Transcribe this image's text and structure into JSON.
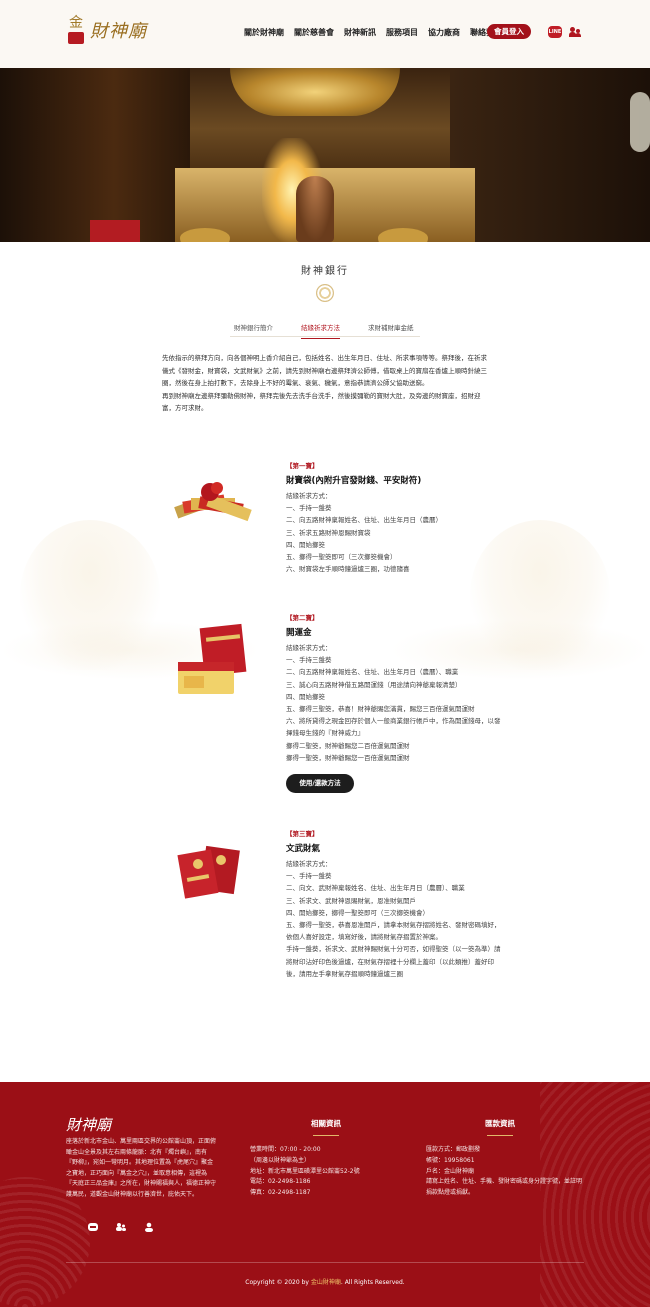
{
  "header": {
    "logo_text": "財神廟",
    "logo_mark": "金",
    "nav": [
      "關於財神廟",
      "關於慈善會",
      "財神新訊",
      "服務項目",
      "協力廠商",
      "聯絡我們"
    ],
    "login_label": "會員登入",
    "line_label": "LINE"
  },
  "page": {
    "title": "財神銀行",
    "tabs": [
      "財神銀行簡介",
      "結緣祈求方法",
      "求財補財庫金紙"
    ],
    "active_tab": 1,
    "intro": "先依指示的祭拜方向，向各個神明上香介紹自己，包括姓名、出生年月日、住址、所求事項等等。祭拜後，在祈求儀式《發財金，財寶袋，文武財氣》之前，請先到財神廟右邊祭拜濟公師傅，借取桌上的寶扇在香爐上順時針繞三圈，然後在身上拍打數下，去除身上不好的霉氣、衰氣、穢氣，意指恭請濟公師父協助送窮。\n再到財神廟左邊祭拜彌勒佛財神，祭拜完後先去洗手台洗手，然後摸彌勒的寶財大肚，及旁邊的財寶座，招財迎富，方可求財。"
  },
  "items": [
    {
      "tag": "【第一寶】",
      "name": "財寶袋(內附升官發財錢、平安財符)",
      "desc": "結緣祈求方式：\n一、手持一盤葵\n二、向五路財神稟報姓名、住址、出生年月日（農曆）\n三、祈求五路財神恩賜財寶袋\n四、開始擲筊\n五、擲得一聖筊即可（三次擲筊機會）\n六、財寶袋左手順時鐘過爐三圈，功德隨喜"
    },
    {
      "tag": "【第二寶】",
      "name": "開運金",
      "desc": "結緣祈求方式：\n一、手持三盤葵\n二、向五路財神稟報姓名、住址、出生年月日（農曆）、職業\n三、誠心向五路財神借五路開運錢（用途請向神爺稟報清楚）\n四、開始擲筊\n五、擲得三聖筊，恭喜！財神爺賜您滿貫，賜您三百倍運氣開運財\n六、將所貸得之現金回存於個人一般商業銀行帳戶中，作為開運錢母，以發揮錢母生錢的『財神威力』\n擲得二聖筊，財神爺賜您二百倍運氣開運財\n擲得一聖筊，財神爺賜您一百倍運氣開運財",
      "button": "使用/還款方法"
    },
    {
      "tag": "【第三寶】",
      "name": "文武財氣",
      "desc": "結緣祈求方式：\n一、手持一盤葵\n二、向文、武財神稟報姓名、住址、出生年月日（農曆）、職業\n三、祈求文、武財神恩賜財氣，恩准財氣開戶\n四、開始擲筊，擲得一聖筊即可（三次擲筊機會）\n五、擲得一聖筊，恭喜恩准開戶，請拿本財氣存摺將姓名、發財密碼填好，依個人喜好設定，填寫好後，請將財氣存摺置於神案。\n手持一盤葵，祈求文、武財神賜財氣十分可否，如得聖筊（以一筊為準）請將財印沾好印色後過爐，在財氣存摺裡十分欄上蓋印（以此類推）蓋好印後，請用左手拿財氣存摺順時鐘過爐三圈"
    }
  ],
  "footer": {
    "logo_text": "財神廟",
    "about": "座落於新北市金山、萬里兩區交界的公館崙山頂，正面俯瞰金山全景及其左右兩條龍脈：北有『燭台嶼』，南有『野柳』，宛如一彎明月。其地理位置為『虎尾穴』聚金之寶地，正巧面向『萬金之穴』，並取意相傳，這裡為『天庭正三品金庫』之所在，財神賜福與人，福德正神守護萬民，道觀金山財神廟以行善濟世，庇佑天下。",
    "contact_title": "相關資訊",
    "contact": [
      "營業時間：07:00 - 20:00",
      "（周邊以財神爺為主）",
      "地址：新北市萬里區磺潭里公館崙52-2號",
      "電話：02-2498-1186",
      "傳真：02-2498-1187"
    ],
    "payment_title": "匯款資訊",
    "payment": [
      "匯款方式：郵政劃撥",
      "帳號：19958061",
      "戶名：金山財神廟",
      "請寫上姓名、住址、手機、發財密碼或身分證字號，並註明捐款點燈或捐獻。"
    ],
    "copyright_prefix": "Copyright © 2020 by ",
    "copyright_brand": "金山財神廟",
    "copyright_suffix": ". All Rights Reserved."
  },
  "colors": {
    "brand_red": "#9b0f16",
    "gold": "#9a6f21",
    "accent_red": "#b0161f"
  }
}
